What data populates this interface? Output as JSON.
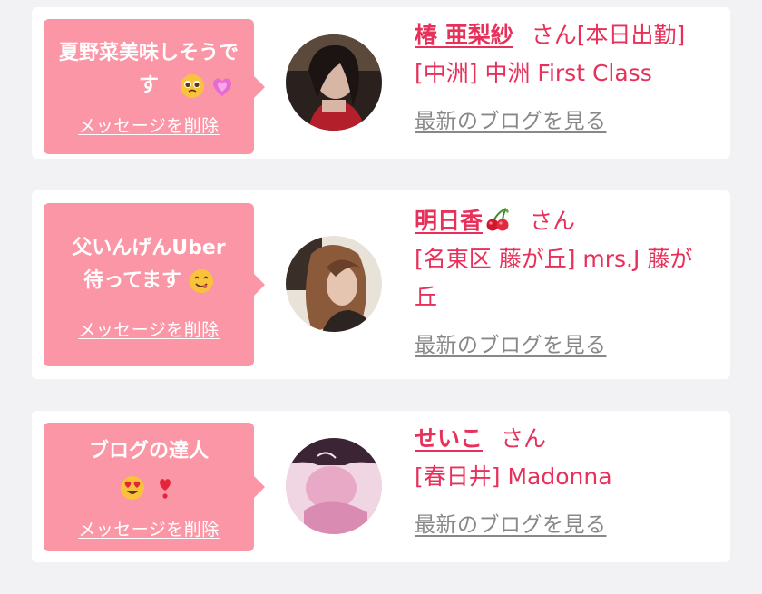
{
  "cards": [
    {
      "message": "夏野菜美味しそうです",
      "delete_label": "メッセージを削除",
      "name": "椿 亜梨紗",
      "honorific": "さん",
      "tag": "[本日出勤]",
      "shop": "[中洲] 中洲 First Class",
      "blog_link": "最新のブログを見る",
      "emojis": [
        "pleading-face",
        "growing-heart"
      ]
    },
    {
      "message_line1": "父いんげんUber",
      "message_line2": "待ってます",
      "delete_label": "メッセージを削除",
      "name": "明日香",
      "honorific": "さん",
      "shop": "[名東区 藤が丘] mrs.J 藤が丘",
      "blog_link": "最新のブログを見る",
      "emojis": [
        "cherries",
        "smiling-face-savoring-food"
      ]
    },
    {
      "message_line1": "ブログの達人",
      "delete_label": "メッセージを削除",
      "name": "せいこ",
      "honorific": "さん",
      "shop": "[春日井] Madonna",
      "blog_link": "最新のブログを見る",
      "emojis": [
        "heart-eyes",
        "exclamation-heart"
      ]
    }
  ],
  "colors": {
    "background": "#f2f2f4",
    "card": "#ffffff",
    "bubble": "#fb96a6",
    "accent": "#e7305a",
    "link_gray": "#888888"
  }
}
